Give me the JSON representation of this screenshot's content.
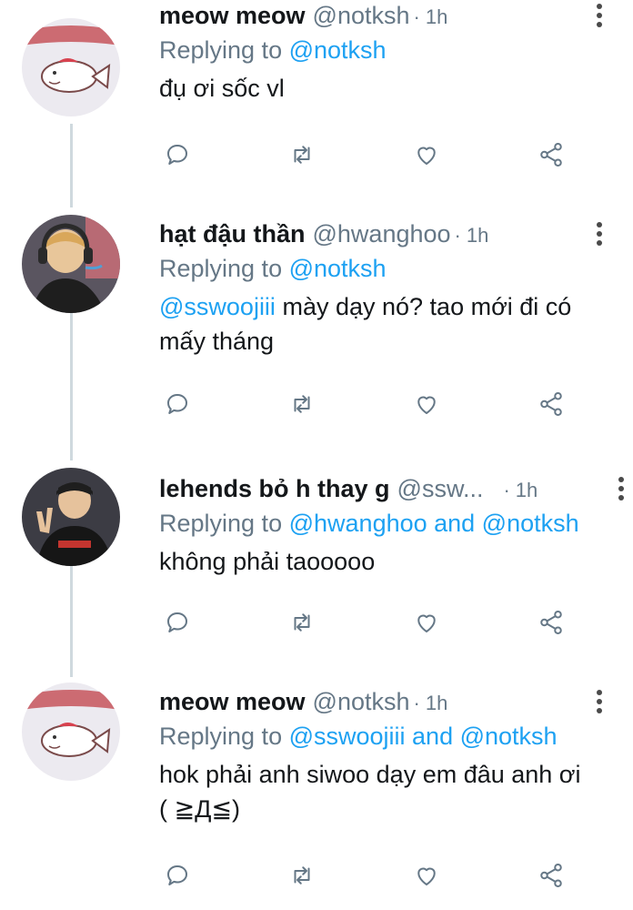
{
  "tweets": [
    {
      "name": "meow meow",
      "handle": "@notksh",
      "dot": "·",
      "time": "1h",
      "replying_prefix": "Replying to",
      "replying_to": "@notksh",
      "text_mention": "",
      "text": "đụ ơi sốc vl",
      "avatar": "pink-fish-avatar"
    },
    {
      "name": "hạt đậu thần",
      "handle": "@hwanghoo",
      "dot": "·",
      "time": "1h",
      "replying_prefix": "Replying to",
      "replying_to": "@notksh",
      "text_mention": "@sswoojiii",
      "text": "mày dạy nó? tao mới đi có mấy tháng",
      "avatar": "player-headset-avatar"
    },
    {
      "name": "lehends bỏ h thay g",
      "handle": "@ssw...",
      "dot": "·",
      "time": "1h",
      "replying_prefix": "Replying to",
      "replying_to": "@hwanghoo and @notksh",
      "text_mention": "",
      "text": "không phải taooooo",
      "avatar": "player-peace-sign-avatar"
    },
    {
      "name": "meow meow",
      "handle": "@notksh",
      "dot": "·",
      "time": "1h",
      "replying_prefix": "Replying to",
      "replying_to": "@sswoojiii and @notksh",
      "text_mention": "",
      "text": "hok phải anh siwoo dạy em đâu anh ơi ( ≧Д≦)",
      "avatar": "pink-fish-avatar"
    }
  ],
  "icons": {
    "reply": "reply-icon",
    "retweet": "retweet-icon",
    "like": "like-icon",
    "share": "share-icon",
    "more": "more-vertical-icon"
  },
  "colors": {
    "link": "#1da1f2",
    "secondary_text": "#657786",
    "thread_line": "#cfd9de"
  }
}
